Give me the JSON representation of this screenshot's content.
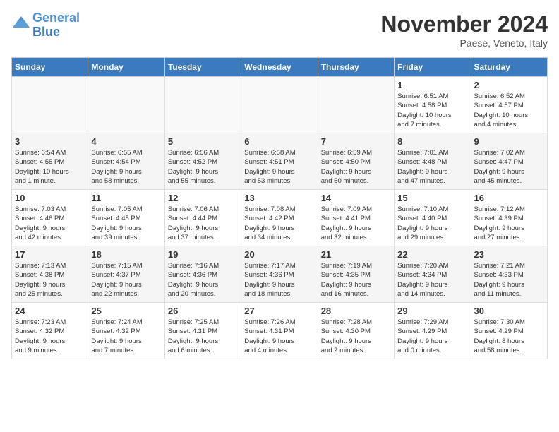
{
  "header": {
    "logo_line1": "General",
    "logo_line2": "Blue",
    "month_title": "November 2024",
    "subtitle": "Paese, Veneto, Italy"
  },
  "weekdays": [
    "Sunday",
    "Monday",
    "Tuesday",
    "Wednesday",
    "Thursday",
    "Friday",
    "Saturday"
  ],
  "weeks": [
    [
      {
        "day": "",
        "info": ""
      },
      {
        "day": "",
        "info": ""
      },
      {
        "day": "",
        "info": ""
      },
      {
        "day": "",
        "info": ""
      },
      {
        "day": "",
        "info": ""
      },
      {
        "day": "1",
        "info": "Sunrise: 6:51 AM\nSunset: 4:58 PM\nDaylight: 10 hours\nand 7 minutes."
      },
      {
        "day": "2",
        "info": "Sunrise: 6:52 AM\nSunset: 4:57 PM\nDaylight: 10 hours\nand 4 minutes."
      }
    ],
    [
      {
        "day": "3",
        "info": "Sunrise: 6:54 AM\nSunset: 4:55 PM\nDaylight: 10 hours\nand 1 minute."
      },
      {
        "day": "4",
        "info": "Sunrise: 6:55 AM\nSunset: 4:54 PM\nDaylight: 9 hours\nand 58 minutes."
      },
      {
        "day": "5",
        "info": "Sunrise: 6:56 AM\nSunset: 4:52 PM\nDaylight: 9 hours\nand 55 minutes."
      },
      {
        "day": "6",
        "info": "Sunrise: 6:58 AM\nSunset: 4:51 PM\nDaylight: 9 hours\nand 53 minutes."
      },
      {
        "day": "7",
        "info": "Sunrise: 6:59 AM\nSunset: 4:50 PM\nDaylight: 9 hours\nand 50 minutes."
      },
      {
        "day": "8",
        "info": "Sunrise: 7:01 AM\nSunset: 4:48 PM\nDaylight: 9 hours\nand 47 minutes."
      },
      {
        "day": "9",
        "info": "Sunrise: 7:02 AM\nSunset: 4:47 PM\nDaylight: 9 hours\nand 45 minutes."
      }
    ],
    [
      {
        "day": "10",
        "info": "Sunrise: 7:03 AM\nSunset: 4:46 PM\nDaylight: 9 hours\nand 42 minutes."
      },
      {
        "day": "11",
        "info": "Sunrise: 7:05 AM\nSunset: 4:45 PM\nDaylight: 9 hours\nand 39 minutes."
      },
      {
        "day": "12",
        "info": "Sunrise: 7:06 AM\nSunset: 4:44 PM\nDaylight: 9 hours\nand 37 minutes."
      },
      {
        "day": "13",
        "info": "Sunrise: 7:08 AM\nSunset: 4:42 PM\nDaylight: 9 hours\nand 34 minutes."
      },
      {
        "day": "14",
        "info": "Sunrise: 7:09 AM\nSunset: 4:41 PM\nDaylight: 9 hours\nand 32 minutes."
      },
      {
        "day": "15",
        "info": "Sunrise: 7:10 AM\nSunset: 4:40 PM\nDaylight: 9 hours\nand 29 minutes."
      },
      {
        "day": "16",
        "info": "Sunrise: 7:12 AM\nSunset: 4:39 PM\nDaylight: 9 hours\nand 27 minutes."
      }
    ],
    [
      {
        "day": "17",
        "info": "Sunrise: 7:13 AM\nSunset: 4:38 PM\nDaylight: 9 hours\nand 25 minutes."
      },
      {
        "day": "18",
        "info": "Sunrise: 7:15 AM\nSunset: 4:37 PM\nDaylight: 9 hours\nand 22 minutes."
      },
      {
        "day": "19",
        "info": "Sunrise: 7:16 AM\nSunset: 4:36 PM\nDaylight: 9 hours\nand 20 minutes."
      },
      {
        "day": "20",
        "info": "Sunrise: 7:17 AM\nSunset: 4:36 PM\nDaylight: 9 hours\nand 18 minutes."
      },
      {
        "day": "21",
        "info": "Sunrise: 7:19 AM\nSunset: 4:35 PM\nDaylight: 9 hours\nand 16 minutes."
      },
      {
        "day": "22",
        "info": "Sunrise: 7:20 AM\nSunset: 4:34 PM\nDaylight: 9 hours\nand 14 minutes."
      },
      {
        "day": "23",
        "info": "Sunrise: 7:21 AM\nSunset: 4:33 PM\nDaylight: 9 hours\nand 11 minutes."
      }
    ],
    [
      {
        "day": "24",
        "info": "Sunrise: 7:23 AM\nSunset: 4:32 PM\nDaylight: 9 hours\nand 9 minutes."
      },
      {
        "day": "25",
        "info": "Sunrise: 7:24 AM\nSunset: 4:32 PM\nDaylight: 9 hours\nand 7 minutes."
      },
      {
        "day": "26",
        "info": "Sunrise: 7:25 AM\nSunset: 4:31 PM\nDaylight: 9 hours\nand 6 minutes."
      },
      {
        "day": "27",
        "info": "Sunrise: 7:26 AM\nSunset: 4:31 PM\nDaylight: 9 hours\nand 4 minutes."
      },
      {
        "day": "28",
        "info": "Sunrise: 7:28 AM\nSunset: 4:30 PM\nDaylight: 9 hours\nand 2 minutes."
      },
      {
        "day": "29",
        "info": "Sunrise: 7:29 AM\nSunset: 4:29 PM\nDaylight: 9 hours\nand 0 minutes."
      },
      {
        "day": "30",
        "info": "Sunrise: 7:30 AM\nSunset: 4:29 PM\nDaylight: 8 hours\nand 58 minutes."
      }
    ]
  ]
}
